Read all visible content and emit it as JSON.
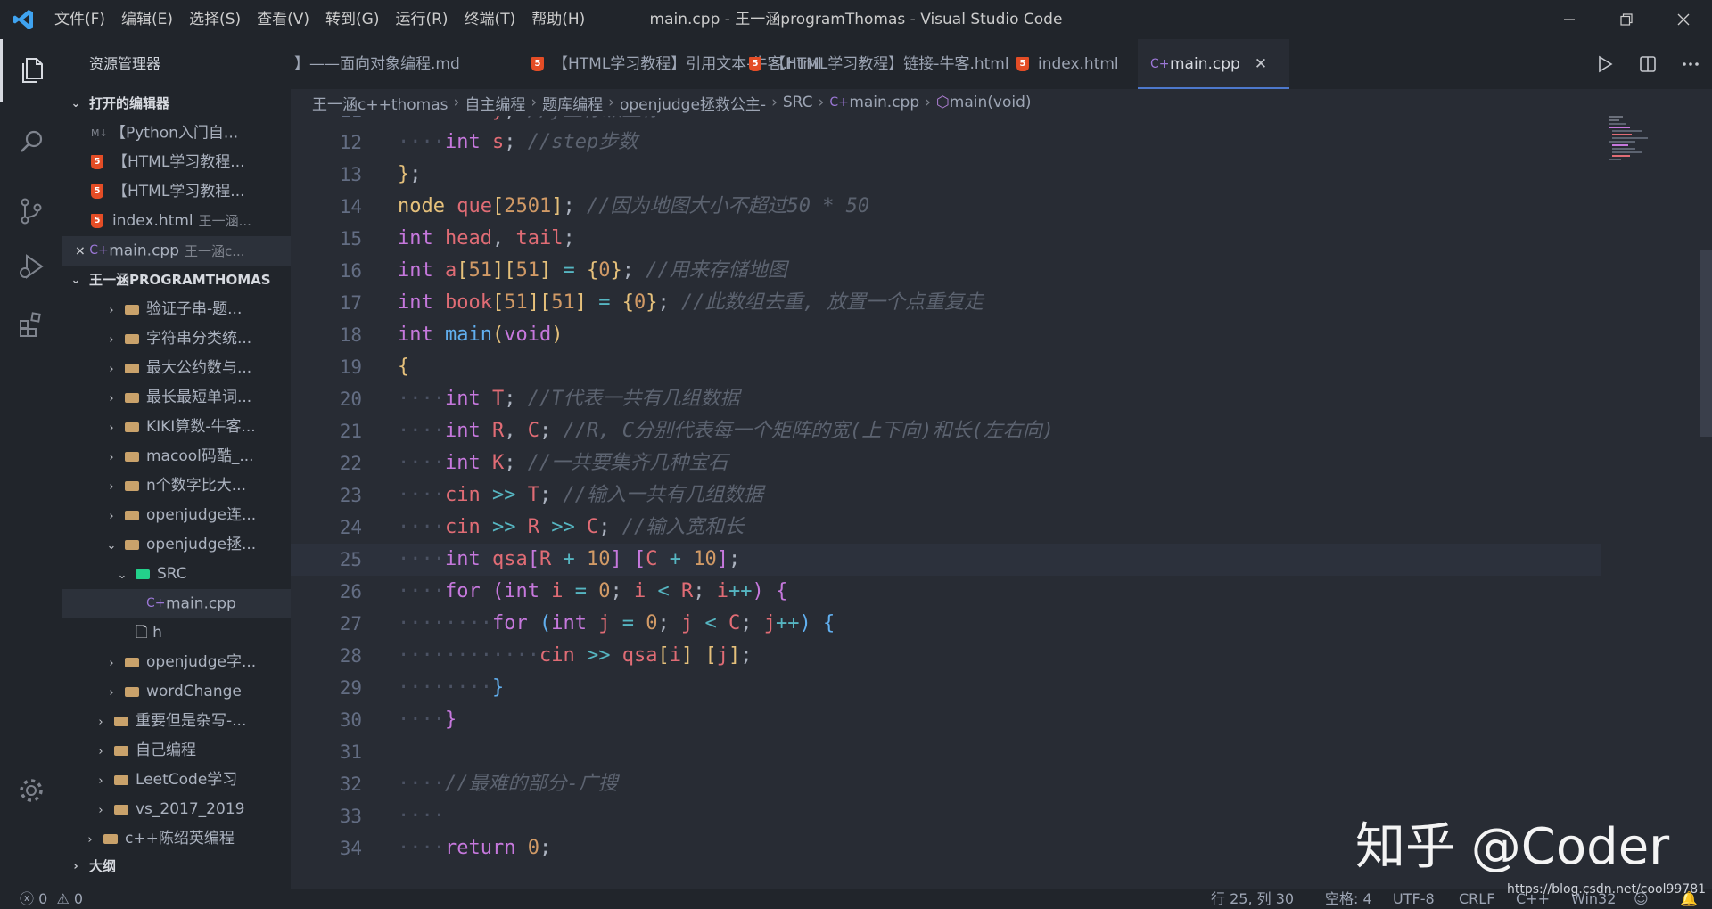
{
  "window": {
    "title": "main.cpp - 王一涵programThomas - Visual Studio Code",
    "menus": [
      "文件(F)",
      "编辑(E)",
      "选择(S)",
      "查看(V)",
      "转到(G)",
      "运行(R)",
      "终端(T)",
      "帮助(H)"
    ]
  },
  "colors": {
    "accent": "#4d78cc",
    "html_icon": "#e44d26",
    "cpp_icon": "#9b77d6",
    "folder": "#c9a26b",
    "src_folder": "#23d18b"
  },
  "sidebar": {
    "title": "资源管理器",
    "open_editors_header": "打开的编辑器",
    "open_editors": [
      {
        "icon": "md-icon",
        "name": "【Python入门自...",
        "detail": ""
      },
      {
        "icon": "html5-icon",
        "name": "【HTML学习教程...",
        "detail": ""
      },
      {
        "icon": "html5-icon",
        "name": "【HTML学习教程...",
        "detail": ""
      },
      {
        "icon": "html5-icon",
        "name": "index.html",
        "detail": "王一涵..."
      },
      {
        "icon": "cpp-icon",
        "name": "main.cpp",
        "detail": "王一涵c..."
      }
    ],
    "workspace_header": "王一涵PROGRAMTHOMAS",
    "tree": [
      {
        "name": "验证子串-题...",
        "depth": 2,
        "type": "folder"
      },
      {
        "name": "字符串分类统...",
        "depth": 2,
        "type": "folder"
      },
      {
        "name": "最大公约数与...",
        "depth": 2,
        "type": "folder"
      },
      {
        "name": "最长最短单词...",
        "depth": 2,
        "type": "folder"
      },
      {
        "name": "KIKI算数-牛客...",
        "depth": 2,
        "type": "folder"
      },
      {
        "name": "macool码酷_...",
        "depth": 2,
        "type": "folder"
      },
      {
        "name": "n个数字比大...",
        "depth": 2,
        "type": "folder"
      },
      {
        "name": "openjudge连...",
        "depth": 2,
        "type": "folder"
      },
      {
        "name": "openjudge拯...",
        "depth": 2,
        "type": "folder-open"
      },
      {
        "name": "SRC",
        "depth": 3,
        "type": "src-open"
      },
      {
        "name": "main.cpp",
        "depth": 4,
        "type": "cpp"
      },
      {
        "name": "h",
        "depth": 3,
        "type": "file"
      },
      {
        "name": "openjudge字...",
        "depth": 2,
        "type": "folder"
      },
      {
        "name": "wordChange",
        "depth": 2,
        "type": "folder"
      },
      {
        "name": "重要但是杂写-...",
        "depth": 1,
        "type": "folder"
      },
      {
        "name": "自己编程",
        "depth": 1,
        "type": "folder"
      },
      {
        "name": "LeetCode学习",
        "depth": 1,
        "type": "folder"
      },
      {
        "name": "vs_2017_2019",
        "depth": 1,
        "type": "folder"
      },
      {
        "name": "c++陈绍英编程",
        "depth": 0,
        "type": "folder"
      }
    ],
    "outline_header": "大纲"
  },
  "tabs": [
    {
      "label": "】——面向对象编程.md",
      "icon": ""
    },
    {
      "label": "【HTML学习教程】引用文本-牛客.html",
      "icon": "html5-icon"
    },
    {
      "label": "【HTML学习教程】链接-牛客.html",
      "icon": "html5-icon"
    },
    {
      "label": "index.html",
      "icon": "html5-icon"
    },
    {
      "label": "main.cpp",
      "icon": "cpp-icon",
      "active": true
    }
  ],
  "breadcrumb": [
    "王一涵c++thomas",
    "自主编程",
    "题库编程",
    "openjudge拯救公主-",
    "SRC",
    "main.cpp",
    "main(void)"
  ],
  "editor": {
    "current_line": 25,
    "lines": [
      {
        "n": "11",
        "indent": 1,
        "toks": [
          [
            "ty",
            "int"
          ],
          [
            "pl",
            " "
          ],
          [
            "id",
            "y"
          ],
          [
            "pl",
            ";"
          ],
          [
            "pl",
            " "
          ],
          [
            "cm",
            "//y坐标纵坐标"
          ]
        ]
      },
      {
        "n": "12",
        "indent": 1,
        "toks": [
          [
            "ty",
            "int"
          ],
          [
            "pl",
            " "
          ],
          [
            "id",
            "s"
          ],
          [
            "pl",
            ";"
          ],
          [
            "pl",
            " "
          ],
          [
            "cm",
            "//step步数"
          ]
        ]
      },
      {
        "n": "13",
        "indent": 0,
        "toks": [
          [
            "br1",
            "}"
          ],
          [
            "pl",
            ";"
          ]
        ]
      },
      {
        "n": "14",
        "indent": 0,
        "toks": [
          [
            "cls",
            "node"
          ],
          [
            "pl",
            " "
          ],
          [
            "id",
            "que"
          ],
          [
            "br1",
            "["
          ],
          [
            "num",
            "2501"
          ],
          [
            "br1",
            "]"
          ],
          [
            "pl",
            ";"
          ],
          [
            "pl",
            " "
          ],
          [
            "cm",
            "//因为地图大小不超过50 * 50"
          ]
        ]
      },
      {
        "n": "15",
        "indent": 0,
        "toks": [
          [
            "ty",
            "int"
          ],
          [
            "pl",
            " "
          ],
          [
            "id",
            "head"
          ],
          [
            "pl",
            ","
          ],
          [
            "pl",
            " "
          ],
          [
            "id",
            "tail"
          ],
          [
            "pl",
            ";"
          ]
        ]
      },
      {
        "n": "16",
        "indent": 0,
        "toks": [
          [
            "ty",
            "int"
          ],
          [
            "pl",
            " "
          ],
          [
            "id",
            "a"
          ],
          [
            "br1",
            "["
          ],
          [
            "num",
            "51"
          ],
          [
            "br1",
            "]"
          ],
          [
            "br1",
            "["
          ],
          [
            "num",
            "51"
          ],
          [
            "br1",
            "]"
          ],
          [
            "pl",
            " "
          ],
          [
            "op",
            "="
          ],
          [
            "pl",
            " "
          ],
          [
            "br1",
            "{"
          ],
          [
            "num",
            "0"
          ],
          [
            "br1",
            "}"
          ],
          [
            "pl",
            ";"
          ],
          [
            "pl",
            " "
          ],
          [
            "cm",
            "//用来存储地图"
          ]
        ]
      },
      {
        "n": "17",
        "indent": 0,
        "toks": [
          [
            "ty",
            "int"
          ],
          [
            "pl",
            " "
          ],
          [
            "id",
            "book"
          ],
          [
            "br1",
            "["
          ],
          [
            "num",
            "51"
          ],
          [
            "br1",
            "]"
          ],
          [
            "br1",
            "["
          ],
          [
            "num",
            "51"
          ],
          [
            "br1",
            "]"
          ],
          [
            "pl",
            " "
          ],
          [
            "op",
            "="
          ],
          [
            "pl",
            " "
          ],
          [
            "br1",
            "{"
          ],
          [
            "num",
            "0"
          ],
          [
            "br1",
            "}"
          ],
          [
            "pl",
            ";"
          ],
          [
            "pl",
            " "
          ],
          [
            "cm",
            "//此数组去重, 放置一个点重复走"
          ]
        ]
      },
      {
        "n": "18",
        "indent": 0,
        "toks": [
          [
            "ty",
            "int"
          ],
          [
            "pl",
            " "
          ],
          [
            "fn",
            "main"
          ],
          [
            "br1",
            "("
          ],
          [
            "ty",
            "void"
          ],
          [
            "br1",
            ")"
          ]
        ]
      },
      {
        "n": "19",
        "indent": 0,
        "toks": [
          [
            "br1",
            "{"
          ]
        ]
      },
      {
        "n": "20",
        "indent": 1,
        "toks": [
          [
            "ty",
            "int"
          ],
          [
            "pl",
            " "
          ],
          [
            "id",
            "T"
          ],
          [
            "pl",
            ";"
          ],
          [
            "pl",
            " "
          ],
          [
            "cm",
            "//T代表一共有几组数据"
          ]
        ]
      },
      {
        "n": "21",
        "indent": 1,
        "toks": [
          [
            "ty",
            "int"
          ],
          [
            "pl",
            " "
          ],
          [
            "id",
            "R"
          ],
          [
            "pl",
            ","
          ],
          [
            "pl",
            " "
          ],
          [
            "id",
            "C"
          ],
          [
            "pl",
            ";"
          ],
          [
            "pl",
            " "
          ],
          [
            "cm",
            "//R, C分别代表每一个矩阵的宽(上下向)和长(左右向)"
          ]
        ]
      },
      {
        "n": "22",
        "indent": 1,
        "toks": [
          [
            "ty",
            "int"
          ],
          [
            "pl",
            " "
          ],
          [
            "id",
            "K"
          ],
          [
            "pl",
            ";"
          ],
          [
            "pl",
            " "
          ],
          [
            "cm",
            "//一共要集齐几种宝石"
          ]
        ]
      },
      {
        "n": "23",
        "indent": 1,
        "toks": [
          [
            "id",
            "cin"
          ],
          [
            "pl",
            " "
          ],
          [
            "op",
            ">>"
          ],
          [
            "pl",
            " "
          ],
          [
            "id",
            "T"
          ],
          [
            "pl",
            ";"
          ],
          [
            "pl",
            " "
          ],
          [
            "cm",
            "//输入一共有几组数据"
          ]
        ]
      },
      {
        "n": "24",
        "indent": 1,
        "toks": [
          [
            "id",
            "cin"
          ],
          [
            "pl",
            " "
          ],
          [
            "op",
            ">>"
          ],
          [
            "pl",
            " "
          ],
          [
            "id",
            "R"
          ],
          [
            "pl",
            " "
          ],
          [
            "op",
            ">>"
          ],
          [
            "pl",
            " "
          ],
          [
            "id",
            "C"
          ],
          [
            "pl",
            ";"
          ],
          [
            "pl",
            " "
          ],
          [
            "cm",
            "//输入宽和长"
          ]
        ]
      },
      {
        "n": "25",
        "indent": 1,
        "toks": [
          [
            "ty",
            "int"
          ],
          [
            "pl",
            " "
          ],
          [
            "id",
            "qsa"
          ],
          [
            "br2",
            "["
          ],
          [
            "id",
            "R"
          ],
          [
            "pl",
            " "
          ],
          [
            "op",
            "+"
          ],
          [
            "pl",
            " "
          ],
          [
            "num",
            "10"
          ],
          [
            "br2",
            "]"
          ],
          [
            "pl",
            " "
          ],
          [
            "br2",
            "["
          ],
          [
            "id",
            "C"
          ],
          [
            "pl",
            " "
          ],
          [
            "op",
            "+"
          ],
          [
            "pl",
            " "
          ],
          [
            "num",
            "10"
          ],
          [
            "br2",
            "]"
          ],
          [
            "pl",
            ";"
          ]
        ]
      },
      {
        "n": "26",
        "indent": 1,
        "toks": [
          [
            "kw",
            "for"
          ],
          [
            "pl",
            " "
          ],
          [
            "br2",
            "("
          ],
          [
            "ty",
            "int"
          ],
          [
            "pl",
            " "
          ],
          [
            "id",
            "i"
          ],
          [
            "pl",
            " "
          ],
          [
            "op",
            "="
          ],
          [
            "pl",
            " "
          ],
          [
            "num",
            "0"
          ],
          [
            "pl",
            ";"
          ],
          [
            "pl",
            " "
          ],
          [
            "id",
            "i"
          ],
          [
            "pl",
            " "
          ],
          [
            "op",
            "<"
          ],
          [
            "pl",
            " "
          ],
          [
            "id",
            "R"
          ],
          [
            "pl",
            ";"
          ],
          [
            "pl",
            " "
          ],
          [
            "id",
            "i"
          ],
          [
            "op",
            "++"
          ],
          [
            "br2",
            ")"
          ],
          [
            "pl",
            " "
          ],
          [
            "br2",
            "{"
          ]
        ]
      },
      {
        "n": "27",
        "indent": 2,
        "toks": [
          [
            "kw",
            "for"
          ],
          [
            "pl",
            " "
          ],
          [
            "br3",
            "("
          ],
          [
            "ty",
            "int"
          ],
          [
            "pl",
            " "
          ],
          [
            "id",
            "j"
          ],
          [
            "pl",
            " "
          ],
          [
            "op",
            "="
          ],
          [
            "pl",
            " "
          ],
          [
            "num",
            "0"
          ],
          [
            "pl",
            ";"
          ],
          [
            "pl",
            " "
          ],
          [
            "id",
            "j"
          ],
          [
            "pl",
            " "
          ],
          [
            "op",
            "<"
          ],
          [
            "pl",
            " "
          ],
          [
            "id",
            "C"
          ],
          [
            "pl",
            ";"
          ],
          [
            "pl",
            " "
          ],
          [
            "id",
            "j"
          ],
          [
            "op",
            "++"
          ],
          [
            "br3",
            ")"
          ],
          [
            "pl",
            " "
          ],
          [
            "br3",
            "{"
          ]
        ]
      },
      {
        "n": "28",
        "indent": 3,
        "toks": [
          [
            "id",
            "cin"
          ],
          [
            "pl",
            " "
          ],
          [
            "op",
            ">>"
          ],
          [
            "pl",
            " "
          ],
          [
            "id",
            "qsa"
          ],
          [
            "br1",
            "["
          ],
          [
            "id",
            "i"
          ],
          [
            "br1",
            "]"
          ],
          [
            "pl",
            " "
          ],
          [
            "br1",
            "["
          ],
          [
            "id",
            "j"
          ],
          [
            "br1",
            "]"
          ],
          [
            "pl",
            ";"
          ]
        ]
      },
      {
        "n": "29",
        "indent": 2,
        "toks": [
          [
            "br3",
            "}"
          ]
        ]
      },
      {
        "n": "30",
        "indent": 1,
        "toks": [
          [
            "br2",
            "}"
          ]
        ]
      },
      {
        "n": "31",
        "indent": 0,
        "toks": []
      },
      {
        "n": "32",
        "indent": 1,
        "toks": [
          [
            "cm",
            "//最难的部分-广搜"
          ]
        ]
      },
      {
        "n": "33",
        "indent": 1,
        "toks": []
      },
      {
        "n": "34",
        "indent": 1,
        "toks": [
          [
            "kw",
            "return"
          ],
          [
            "pl",
            " "
          ],
          [
            "num",
            "0"
          ],
          [
            "pl",
            ";"
          ]
        ]
      }
    ]
  },
  "statusbar": {
    "errors": "0",
    "warnings": "0",
    "position": "行 25, 列 30",
    "spaces": "空格: 4",
    "encoding": "UTF-8",
    "eol": "CRLF",
    "language": "C++",
    "platform": "Win32"
  },
  "watermark": "知乎 @Coder",
  "url_watermark": "https://blog.csdn.net/cool99781"
}
